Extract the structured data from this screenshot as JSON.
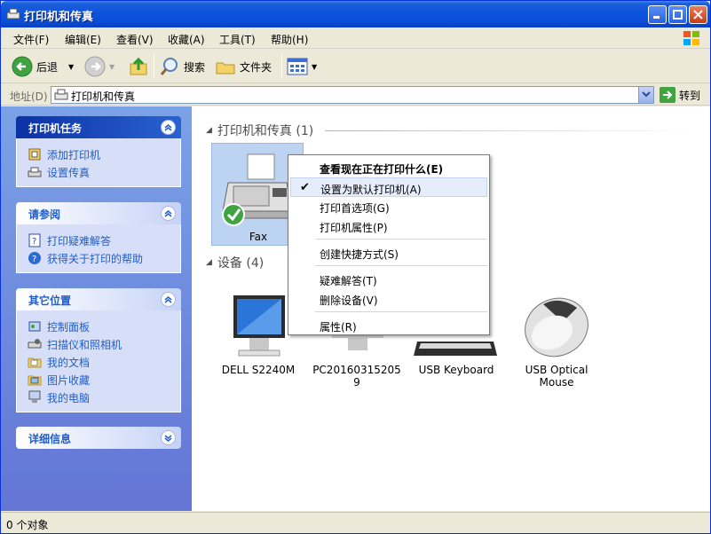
{
  "window": {
    "title": "打印机和传真"
  },
  "menu": [
    "文件(F)",
    "编辑(E)",
    "查看(V)",
    "收藏(A)",
    "工具(T)",
    "帮助(H)"
  ],
  "toolbar": {
    "back": "后退",
    "search": "搜索",
    "folders": "文件夹"
  },
  "address": {
    "label": "地址(D)",
    "value": "打印机和传真",
    "go": "转到"
  },
  "tasks": {
    "printer_tasks": {
      "title": "打印机任务",
      "items": [
        "添加打印机",
        "设置传真"
      ]
    },
    "see_also": {
      "title": "请参阅",
      "items": [
        "打印疑难解答",
        "获得关于打印的帮助"
      ]
    },
    "other_places": {
      "title": "其它位置",
      "items": [
        "控制面板",
        "扫描仪和照相机",
        "我的文档",
        "图片收藏",
        "我的电脑"
      ]
    },
    "details": {
      "title": "详细信息"
    }
  },
  "groups": {
    "printers": {
      "title": "打印机和传真 (1)",
      "items": [
        "Fax"
      ]
    },
    "devices": {
      "title": "设备 (4)",
      "items": [
        "DELL S2240M",
        "PC20160315205\n9",
        "USB Keyboard",
        "USB Optical\nMouse"
      ]
    }
  },
  "context_menu": {
    "items": [
      "查看现在正在打印什么(E)",
      "设置为默认打印机(A)",
      "打印首选项(G)",
      "打印机属性(P)",
      "创建快捷方式(S)",
      "疑难解答(T)",
      "删除设备(V)",
      "属性(R)"
    ],
    "checked": "设置为默认打印机(A)"
  },
  "status": {
    "text": "0 个对象"
  },
  "colors": {
    "titlebar": "#0A53DF",
    "link": "#215DC6",
    "panel": "#6375D6"
  }
}
